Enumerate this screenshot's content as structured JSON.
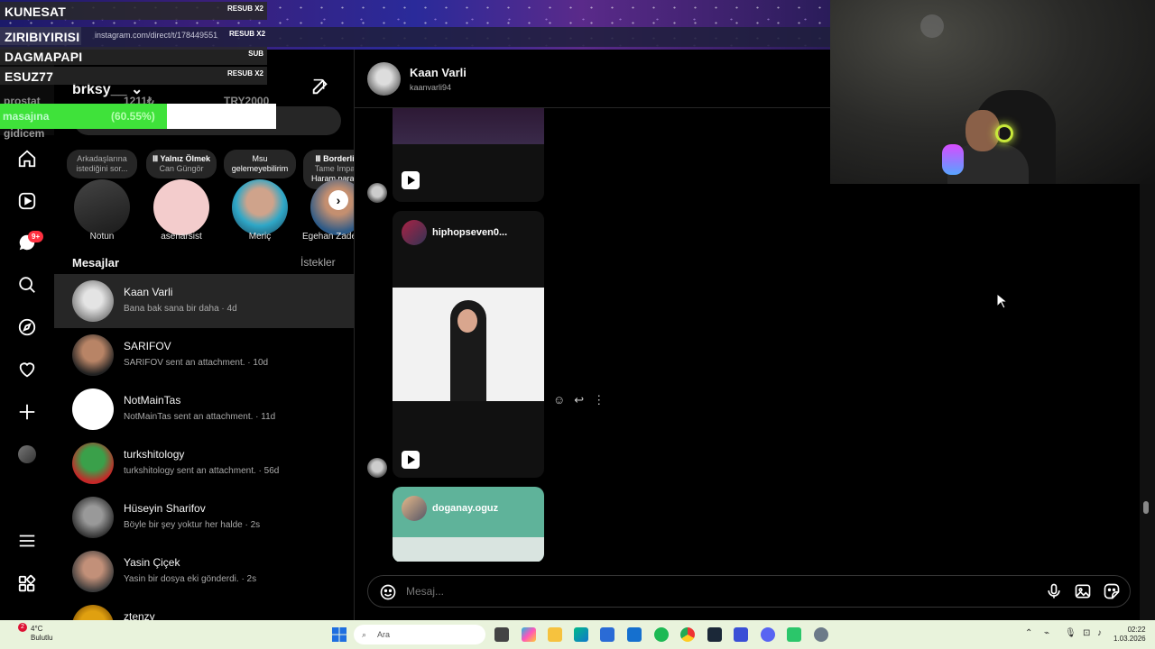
{
  "browser": {
    "url": "instagram.com/direct/t/178449551"
  },
  "overlay": {
    "events": [
      {
        "name": "KUNESAT",
        "tag": "RESUB X2"
      },
      {
        "name": "ZIRIBIYIRISI",
        "tag": "RESUB X2"
      },
      {
        "name": "DAGMAPAPI",
        "tag": "SUB"
      },
      {
        "name": "ESUZ77",
        "tag": "RESUB X2"
      }
    ],
    "goal_label": "masajına",
    "goal_percent_text": "(60.55%)",
    "goal_fraction": 0.6055,
    "dim_left": "prostat",
    "dim_mid": "1211₺",
    "dim_right": "TRY2000",
    "dim_bottom": "gidicem"
  },
  "sidebar": {
    "notif_badge": "9+"
  },
  "inbox": {
    "username": "brksy__",
    "notes": [
      {
        "line1": "Arkadaşlarına",
        "line2": "istediğini sor..."
      },
      {
        "line1": "Ⅲ Yalnız Ölmek",
        "line2": "Can Güngör"
      },
      {
        "line1": "Msu",
        "line2": "gelemeyebilirim"
      },
      {
        "line1": "Ⅲ Borderli",
        "line2": "Tame Impa"
      }
    ],
    "note_extra": "Haram paray",
    "stories": [
      {
        "name": "Notun"
      },
      {
        "name": "asenarsist"
      },
      {
        "name": "Meriç"
      },
      {
        "name": "Egehan Zade"
      }
    ],
    "messages_title": "Mesajlar",
    "requests_link": "İstekler",
    "conversations": [
      {
        "name": "Kaan Varli",
        "preview": "Bana bak sana bir daha · 4d"
      },
      {
        "name": "SARIFOV",
        "preview": "SARIFOV sent an attachment. · 10d"
      },
      {
        "name": "NotMainTas",
        "preview": "NotMainTas sent an attachment. · 11d"
      },
      {
        "name": "turkshitology",
        "preview": "turkshitology sent an attachment. · 56d"
      },
      {
        "name": "Hüseyin Sharifov",
        "preview": "Böyle bir şey yoktur her halde · 2s"
      },
      {
        "name": "Yasin Çiçek",
        "preview": "Yasin bir dosya eki gönderdi. · 2s"
      },
      {
        "name": "ztenzy",
        "preview": ""
      }
    ]
  },
  "chat": {
    "name": "Kaan Varli",
    "handle": "kaanvarli94",
    "reels": [
      {
        "author": "hiphopseven0..."
      },
      {
        "author": "doganay.oguz"
      }
    ],
    "composer_placeholder": "Mesaj..."
  },
  "taskbar": {
    "temp": "4°C",
    "weather": "Bulutlu",
    "weather_badge": "2",
    "search_label": "Ara",
    "time": "02:22",
    "date": "1.03.2026"
  },
  "colors": {
    "goal_fill": "#3fe23a",
    "badge": "#ff3040",
    "taskbar": "#e9f3dc"
  }
}
